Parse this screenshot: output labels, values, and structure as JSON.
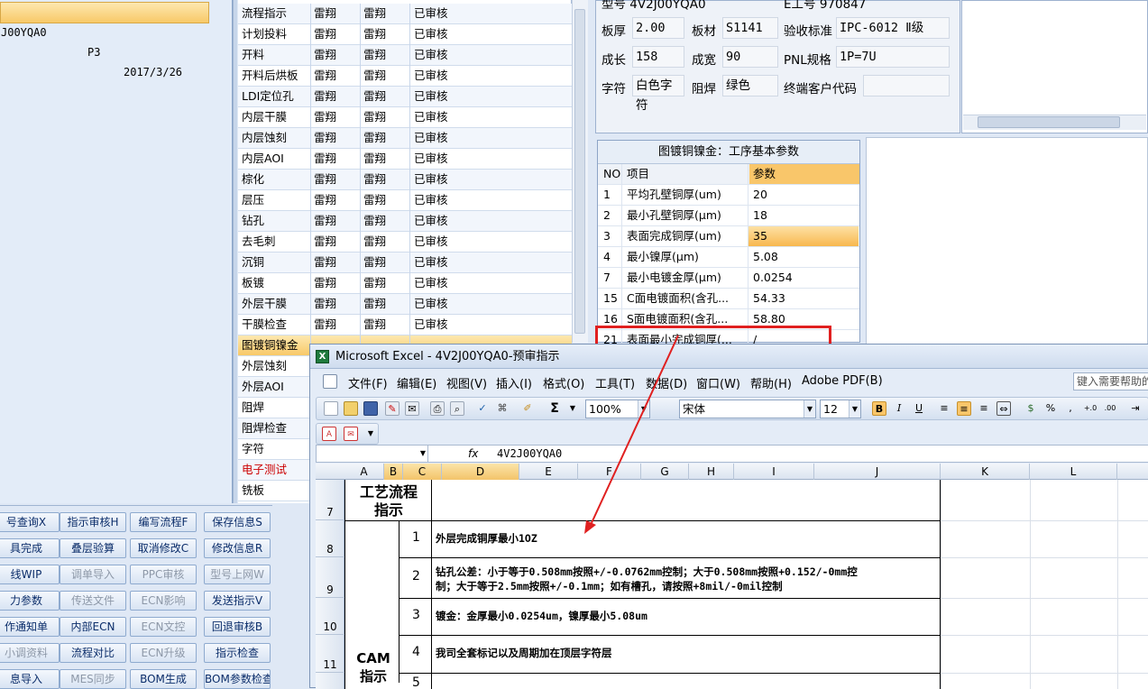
{
  "left_panel": {
    "selected_row": {
      "code": "J00YQA0",
      "layer": "P3",
      "date": "2017/3/26"
    }
  },
  "process_list": [
    {
      "step": "流程指示",
      "c2": "雷翔",
      "c3": "雷翔",
      "status": "已审核"
    },
    {
      "step": "计划投料",
      "c2": "雷翔",
      "c3": "雷翔",
      "status": "已审核"
    },
    {
      "step": "开料",
      "c2": "雷翔",
      "c3": "雷翔",
      "status": "已审核"
    },
    {
      "step": "开料后烘板",
      "c2": "雷翔",
      "c3": "雷翔",
      "status": "已审核"
    },
    {
      "step": "LDI定位孔",
      "c2": "雷翔",
      "c3": "雷翔",
      "status": "已审核"
    },
    {
      "step": "内层干膜",
      "c2": "雷翔",
      "c3": "雷翔",
      "status": "已审核"
    },
    {
      "step": "内层蚀刻",
      "c2": "雷翔",
      "c3": "雷翔",
      "status": "已审核"
    },
    {
      "step": "内层AOI",
      "c2": "雷翔",
      "c3": "雷翔",
      "status": "已审核"
    },
    {
      "step": "棕化",
      "c2": "雷翔",
      "c3": "雷翔",
      "status": "已审核"
    },
    {
      "step": "层压",
      "c2": "雷翔",
      "c3": "雷翔",
      "status": "已审核"
    },
    {
      "step": "钻孔",
      "c2": "雷翔",
      "c3": "雷翔",
      "status": "已审核"
    },
    {
      "step": "去毛刺",
      "c2": "雷翔",
      "c3": "雷翔",
      "status": "已审核"
    },
    {
      "step": "沉铜",
      "c2": "雷翔",
      "c3": "雷翔",
      "status": "已审核"
    },
    {
      "step": "板镀",
      "c2": "雷翔",
      "c3": "雷翔",
      "status": "已审核"
    },
    {
      "step": "外层干膜",
      "c2": "雷翔",
      "c3": "雷翔",
      "status": "已审核"
    },
    {
      "step": "干膜检查",
      "c2": "雷翔",
      "c3": "雷翔",
      "status": "已审核"
    },
    {
      "step": "图镀铜镍金",
      "c2": "",
      "c3": "",
      "status": ""
    },
    {
      "step": "外层蚀刻",
      "c2": "",
      "c3": "",
      "status": ""
    },
    {
      "step": "外层AOI",
      "c2": "",
      "c3": "",
      "status": ""
    },
    {
      "step": "阻焊",
      "c2": "",
      "c3": "",
      "status": ""
    },
    {
      "step": "阻焊检查",
      "c2": "",
      "c3": "",
      "status": ""
    },
    {
      "step": "字符",
      "c2": "",
      "c3": "",
      "status": ""
    },
    {
      "step": "电子测试",
      "c2": "",
      "c3": "",
      "status": ""
    },
    {
      "step": "铣板",
      "c2": "",
      "c3": "",
      "status": ""
    }
  ],
  "info": {
    "top_cut_1": "型号  4V2J00YQA0",
    "top_cut_2": "E工号  970847",
    "thickness_label": "板厚",
    "thickness": "2.00",
    "material_label": "板材",
    "material": "S1141",
    "standard_label": "验收标准",
    "standard": "IPC-6012 Ⅱ级",
    "length_label": "成长",
    "length": "158",
    "width_label": "成宽",
    "width": "90",
    "pnl_label": "PNL规格",
    "pnl": "1P=7U",
    "char_label": "字符",
    "char": "白色字符",
    "mask_label": "阻焊",
    "mask": "绿色",
    "enduser_label": "终端客户代码",
    "enduser": ""
  },
  "param_table": {
    "title": "图镀铜镍金：工序基本参数",
    "headers": {
      "no": "NO",
      "item": "项目",
      "value": "参数"
    },
    "rows": [
      {
        "no": "1",
        "item": "平均孔壁铜厚(um)",
        "value": "20"
      },
      {
        "no": "2",
        "item": "最小孔壁铜厚(μm)",
        "value": "18"
      },
      {
        "no": "3",
        "item": "表面完成铜厚(um)",
        "value": "35"
      },
      {
        "no": "4",
        "item": "最小镍厚(μm)",
        "value": "5.08"
      },
      {
        "no": "7",
        "item": "最小电镀金厚(μm)",
        "value": "0.0254"
      },
      {
        "no": "15",
        "item": "C面电镀面积(含孔...",
        "value": "54.33"
      },
      {
        "no": "16",
        "item": "S面电镀面积(含孔...",
        "value": "58.80"
      },
      {
        "no": "21",
        "item": "表面最小完成铜厚(...",
        "value": "/"
      }
    ]
  },
  "buttons": [
    [
      "号查询X",
      "指示审核H",
      "编写流程F",
      "保存信息S"
    ],
    [
      "具完成",
      "叠层验算",
      "取消修改C",
      "修改信息R"
    ],
    [
      "线WIP",
      "调单导入",
      "PPC审核",
      "型号上网W"
    ],
    [
      "力参数",
      "传送文件",
      "ECN影响",
      "发送指示V"
    ],
    [
      "作通知单",
      "内部ECN",
      "ECN文控",
      "回退审核B"
    ],
    [
      "小调资料",
      "流程对比",
      "ECN升级",
      "指示检查"
    ],
    [
      "息导入",
      "MES同步",
      "BOM生成",
      "BOM参数检查"
    ]
  ],
  "excel": {
    "title": "Microsoft Excel - 4V2J00YQA0-预审指示",
    "menu": [
      "文件(F)",
      "编辑(E)",
      "视图(V)",
      "插入(I)",
      "格式(O)",
      "工具(T)",
      "数据(D)",
      "窗口(W)",
      "帮助(H)",
      "Adobe PDF(B)"
    ],
    "help_placeholder": "键入需要帮助的问题",
    "zoom": "100%",
    "font": "宋体",
    "font_size": "12",
    "formula_value": "4V2J00YQA0",
    "columns": [
      "A",
      "B",
      "C",
      "D",
      "E",
      "F",
      "G",
      "H",
      "I",
      "J",
      "K",
      "L"
    ],
    "rows": [
      "7",
      "8",
      "9",
      "10",
      "11"
    ],
    "header_title": "工艺流程\n指示",
    "cam_label": "CAM\n指示",
    "items": [
      {
        "n": "1",
        "text": "外层完成铜厚最小1OZ"
      },
      {
        "n": "2",
        "text": "钻孔公差：小于等于0.508mm按照+/-0.0762mm控制；大于0.508mm按照+0.152/-0mm控\n制；大于等于2.5mm按照+/-0.1mm；如有槽孔，请按照+8mil/-0mil控制"
      },
      {
        "n": "3",
        "text": "镀金：金厚最小0.0254um，镍厚最小5.08um"
      },
      {
        "n": "4",
        "text": "我司全套标记以及周期加在顶层字符层"
      },
      {
        "n": "5",
        "text": ""
      }
    ]
  },
  "colors": {
    "highlight": "#f8c968",
    "annotation": "#e02020",
    "panel": "#dfe8f5"
  }
}
